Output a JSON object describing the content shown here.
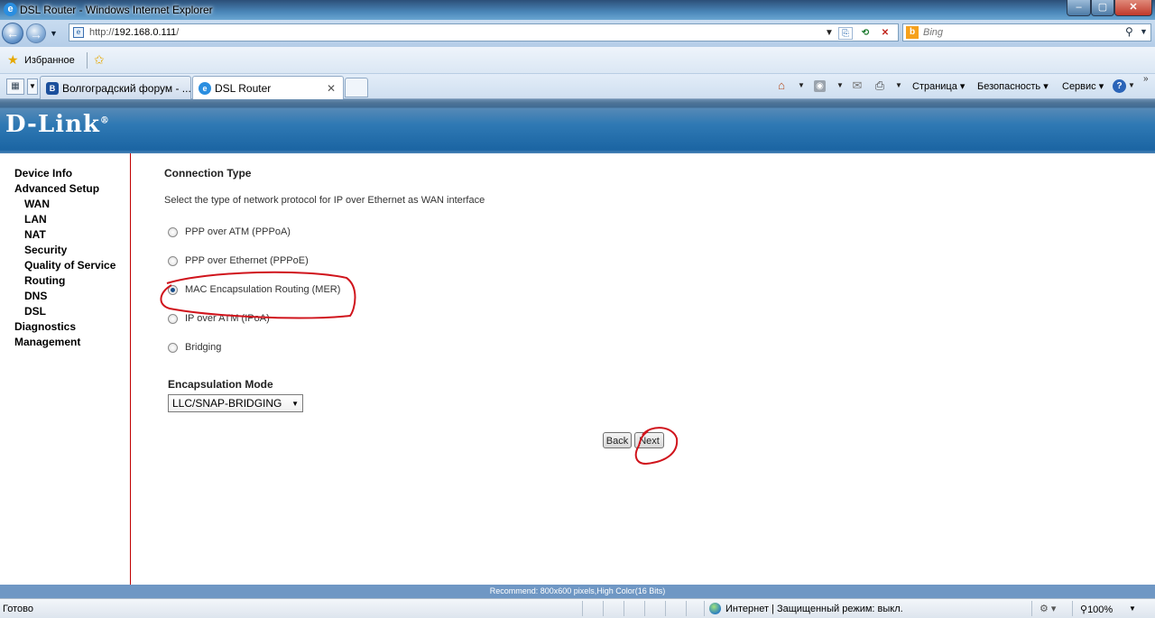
{
  "window": {
    "title": "DSL Router - Windows Internet Explorer"
  },
  "address": {
    "url_prefix": "http://",
    "url_host": "192.168.0.111",
    "url_suffix": "/"
  },
  "search": {
    "placeholder": "Bing"
  },
  "favorites": {
    "label": "Избранное"
  },
  "tabs": [
    {
      "label": "Волгоградский форум - ..."
    },
    {
      "label": "DSL Router"
    }
  ],
  "commands": {
    "page": "Страница",
    "safety": "Безопасность",
    "tools": "Сервис"
  },
  "router": {
    "logo": "D-Link",
    "nav": [
      {
        "label": "Device Info"
      },
      {
        "label": "Advanced Setup"
      },
      {
        "label": "WAN"
      },
      {
        "label": "LAN"
      },
      {
        "label": "NAT"
      },
      {
        "label": "Security"
      },
      {
        "label": "Quality of Service"
      },
      {
        "label": "Routing"
      },
      {
        "label": "DNS"
      },
      {
        "label": "DSL"
      },
      {
        "label": "Diagnostics"
      },
      {
        "label": "Management"
      }
    ],
    "connection_title": "Connection Type",
    "connection_desc": "Select the type of network protocol for IP over Ethernet as WAN interface",
    "options": [
      {
        "label": "PPP over ATM (PPPoA)",
        "checked": false
      },
      {
        "label": "PPP over Ethernet (PPPoE)",
        "checked": false
      },
      {
        "label": "MAC Encapsulation Routing (MER)",
        "checked": true
      },
      {
        "label": "IP over ATM (IPoA)",
        "checked": false
      },
      {
        "label": "Bridging",
        "checked": false
      }
    ],
    "encapsulation_title": "Encapsulation Mode",
    "encapsulation_value": "LLC/SNAP-BRIDGING",
    "back_label": "Back",
    "next_label": "Next",
    "footer": "Recommend: 800x600 pixels,High Color(16 Bits)"
  },
  "status": {
    "text": "Готово",
    "zone": "Интернет | Защищенный режим: выкл.",
    "zoom": "100%"
  },
  "colors": {
    "annotation": "#d0141c",
    "sidebar_border": "#c00000"
  }
}
